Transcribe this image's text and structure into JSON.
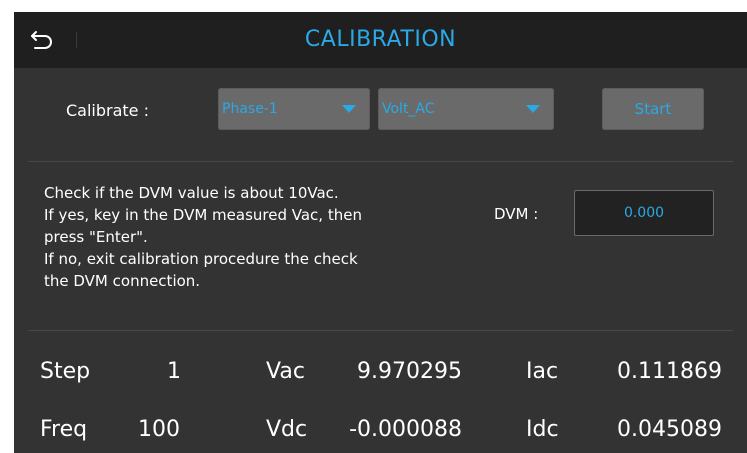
{
  "header": {
    "title": "CALIBRATION",
    "back_icon": "back-arrow-icon"
  },
  "controls": {
    "calibrate_label": "Calibrate :",
    "phase_select": "Phase-1",
    "mode_select": "Volt_AC",
    "start_label": "Start"
  },
  "instructions": [
    "Check if the DVM value is about 10Vac.",
    "If yes, key in the DVM measured Vac, then",
    "press \"Enter\".",
    "If no, exit calibration procedure the check",
    "the DVM connection."
  ],
  "dvm": {
    "label": "DVM :",
    "value": "0.000"
  },
  "readings": {
    "step_label": "Step",
    "step_value": "1",
    "freq_label": "Freq",
    "freq_value": "100",
    "vac_label": "Vac",
    "vac_value": "9.970295",
    "vdc_label": "Vdc",
    "vdc_value": "-0.000088",
    "iac_label": "Iac",
    "iac_value": "0.111869",
    "idc_label": "Idc",
    "idc_value": "0.045089"
  },
  "colors": {
    "accent": "#2aa9e6",
    "background": "#333333",
    "titlebar": "#1f1f1f",
    "control": "#6a6a6a"
  }
}
